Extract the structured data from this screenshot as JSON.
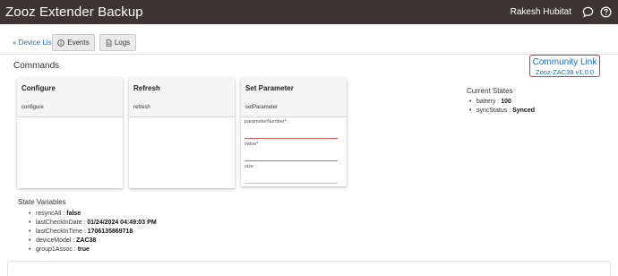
{
  "header": {
    "app_title": "Zooz Extender Backup",
    "user_name": "Rakesh Hubitat",
    "icons": [
      "chat-icon",
      "help-icon"
    ]
  },
  "toolbar": {
    "device_list_label": "« Device List",
    "events_label": "Events",
    "logs_label": "Logs",
    "events_icon": "info-icon",
    "logs_icon": "document-icon"
  },
  "commands": {
    "title": "Commands",
    "cards": [
      {
        "title": "Configure",
        "command": "configure"
      },
      {
        "title": "Refresh",
        "command": "refresh"
      },
      {
        "title": "Set Parameter",
        "command": "setParameter"
      }
    ],
    "set_parameter_fields": [
      {
        "label": "parameterNumber* :",
        "required": true
      },
      {
        "label": "value* :",
        "required": true
      },
      {
        "label": "size :",
        "required": false
      }
    ]
  },
  "community": {
    "link_label": "Community Link",
    "version_label": "Zooz-ZAC38 v1.0.0",
    "border_color": "#dd3333"
  },
  "current_states": {
    "title": "Current States",
    "items": [
      {
        "name": "battery",
        "value": "100"
      },
      {
        "name": "syncStatus",
        "value": "Synced"
      }
    ]
  },
  "state_variables": {
    "title": "State Variables",
    "items": [
      {
        "name": "resyncAll",
        "value": "false"
      },
      {
        "name": "lastCheckInDate",
        "value": "01/24/2024 04:49:03 PM"
      },
      {
        "name": "lastCheckInTime",
        "value": "1706135869718"
      },
      {
        "name": "deviceModel",
        "value": "ZAC38"
      },
      {
        "name": "group1Assoc",
        "value": "true"
      }
    ]
  },
  "colors": {
    "header_bg": "#3b3633",
    "link": "#1d6fb8",
    "required_underline": "#e06060"
  }
}
